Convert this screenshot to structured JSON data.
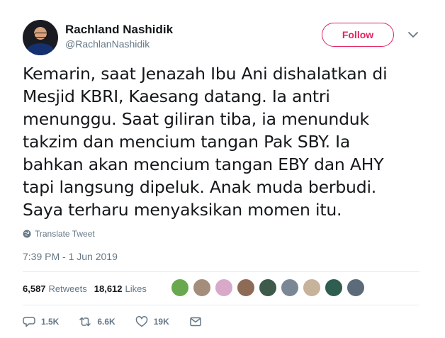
{
  "author": {
    "name": "Rachland Nashidik",
    "handle": "@RachlanNashidik"
  },
  "follow_label": "Follow",
  "tweet_text": "Kemarin, saat Jenazah Ibu Ani dishalatkan di\nMesjid KBRI, Kaesang datang. Ia antri\nmenunggu. Saat giliran tiba, ia menunduk\ntakzim dan mencium tangan Pak SBY. Ia\nbahkan akan mencium tangan EBY dan AHY\ntapi langsung dipeluk. Anak muda berbudi.\nSaya terharu menyaksikan momen itu.",
  "translate_label": "Translate Tweet",
  "timestamp": "7:39 PM - 1 Jun 2019",
  "stats": {
    "retweets_count": "6,587",
    "retweets_label": "Retweets",
    "likes_count": "18,612",
    "likes_label": "Likes"
  },
  "actions": {
    "replies": "1.5K",
    "retweets": "6.6K",
    "likes": "19K"
  },
  "icons": [
    "chevron-down-icon",
    "globe-icon",
    "reply-icon",
    "retweet-icon",
    "heart-icon",
    "message-icon"
  ],
  "colors": {
    "follow_accent": "#e0245e",
    "secondary_text": "#657786",
    "primary_text": "#14171a"
  }
}
